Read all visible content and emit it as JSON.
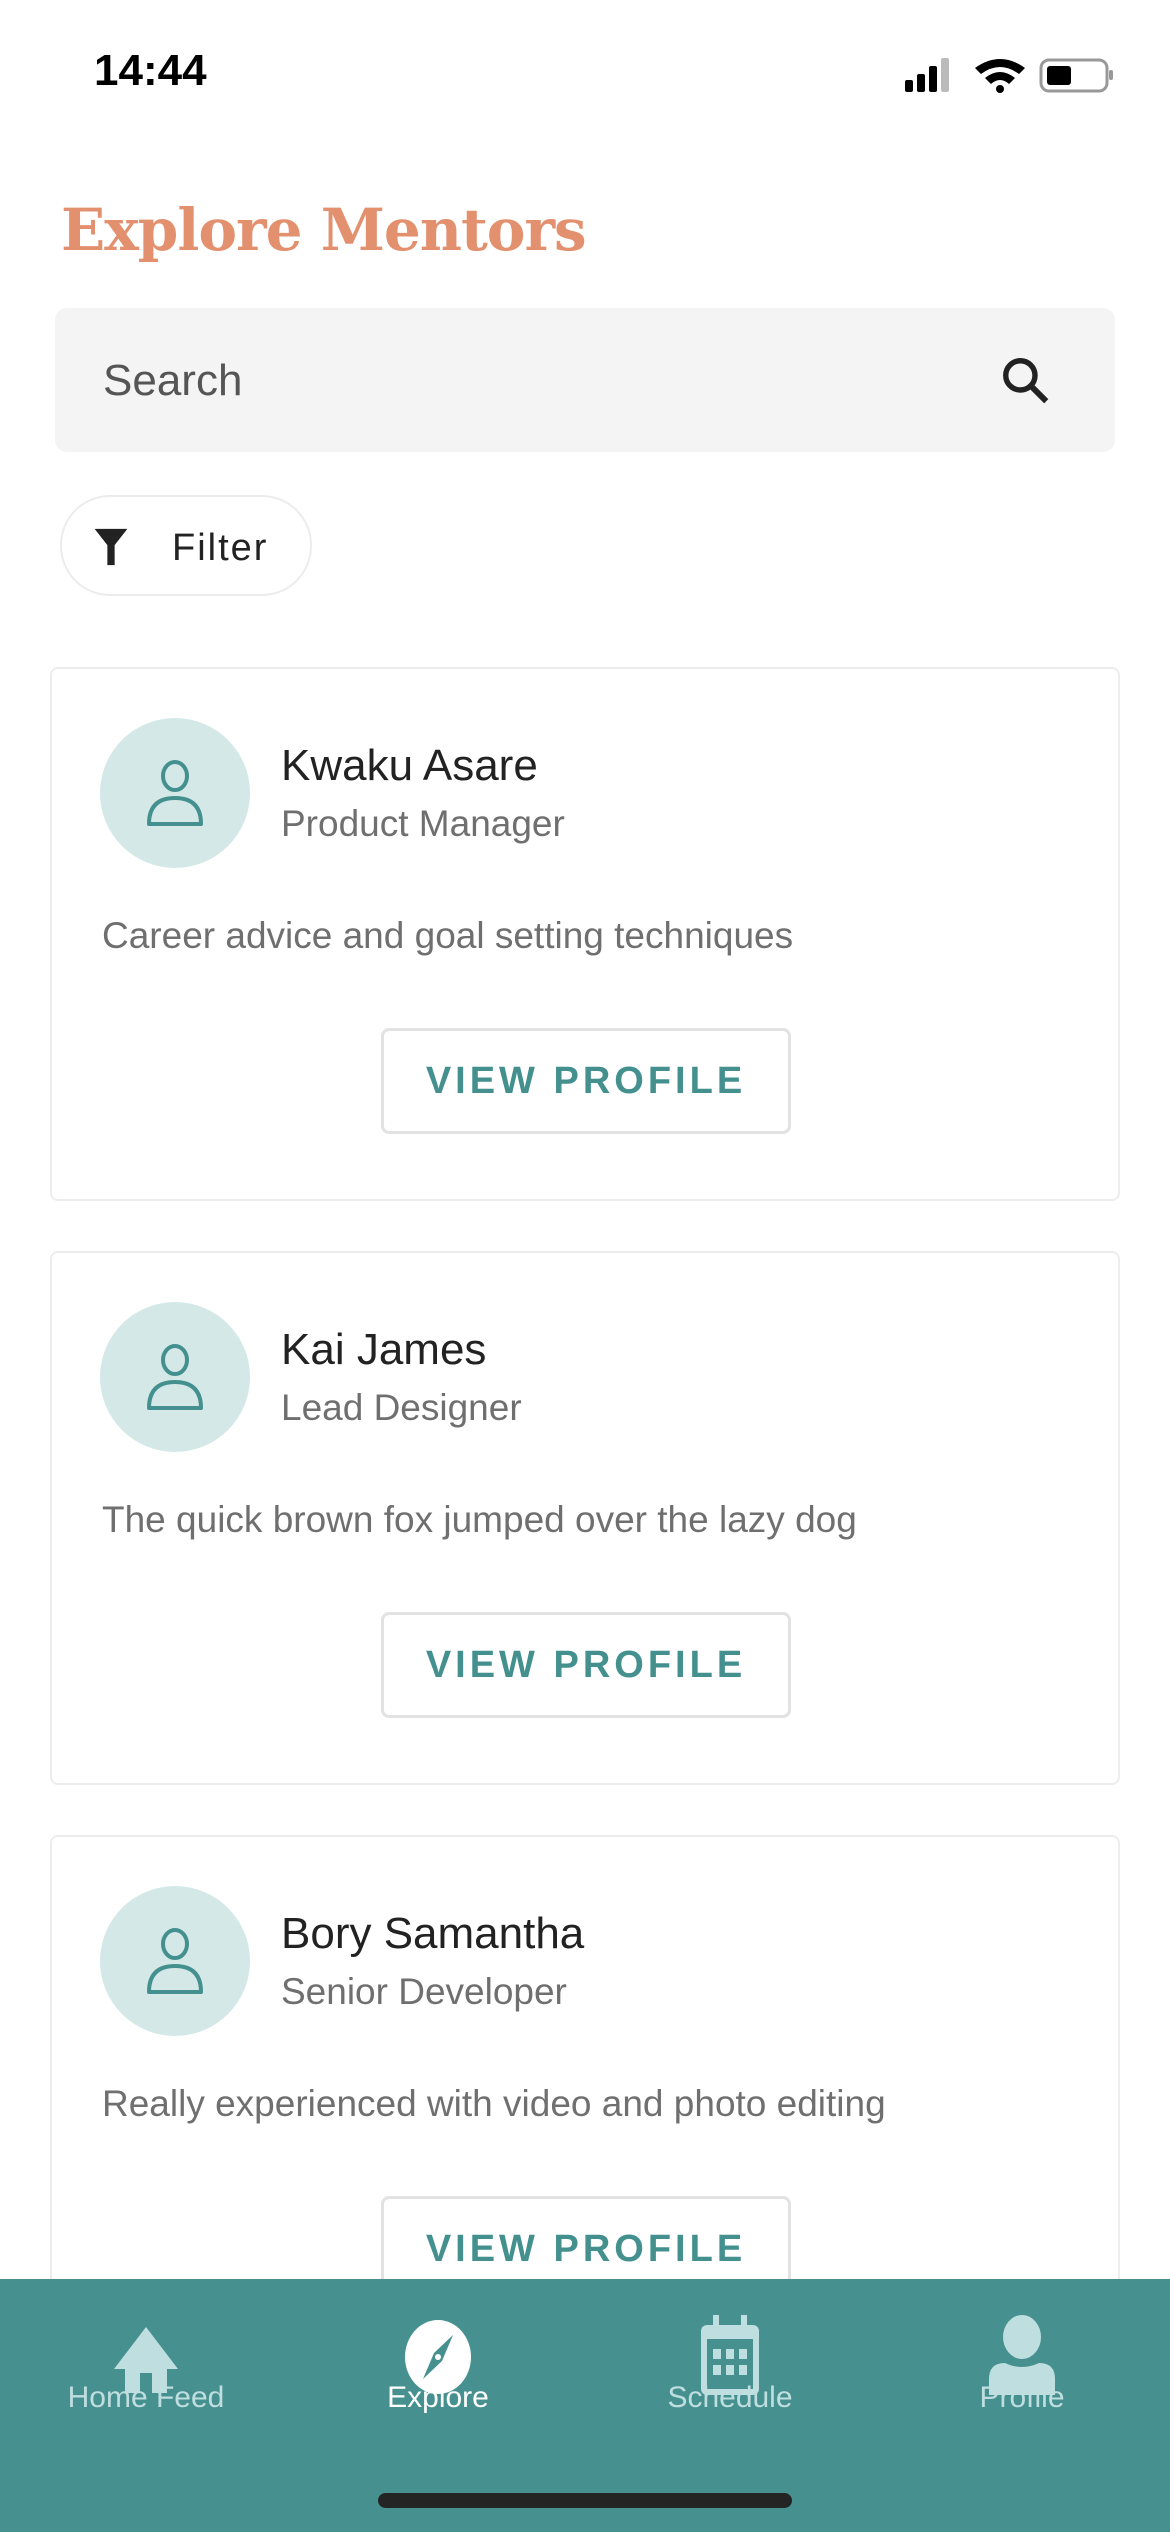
{
  "status_bar": {
    "time": "14:44"
  },
  "header": {
    "title": "Explore Mentors"
  },
  "search": {
    "placeholder": "Search"
  },
  "filter": {
    "label": "Filter"
  },
  "mentors": [
    {
      "name": "Kwaku Asare",
      "role": "Product Manager",
      "description": "Career advice and goal setting techniques",
      "button": "VIEW PROFILE"
    },
    {
      "name": "Kai James",
      "role": "Lead Designer",
      "description": "The quick brown fox jumped over the lazy dog",
      "button": "VIEW PROFILE"
    },
    {
      "name": "Bory Samantha",
      "role": "Senior Developer",
      "description": "Really experienced with video and photo editing",
      "button": "VIEW PROFILE"
    }
  ],
  "tabs": [
    {
      "label": "Home Feed",
      "icon": "home-icon"
    },
    {
      "label": "Explore",
      "icon": "compass-icon",
      "active": true
    },
    {
      "label": "Schedule",
      "icon": "calendar-icon"
    },
    {
      "label": "Profile",
      "icon": "person-icon"
    }
  ],
  "colors": {
    "accent": "#46918f",
    "title": "#e3906f"
  }
}
